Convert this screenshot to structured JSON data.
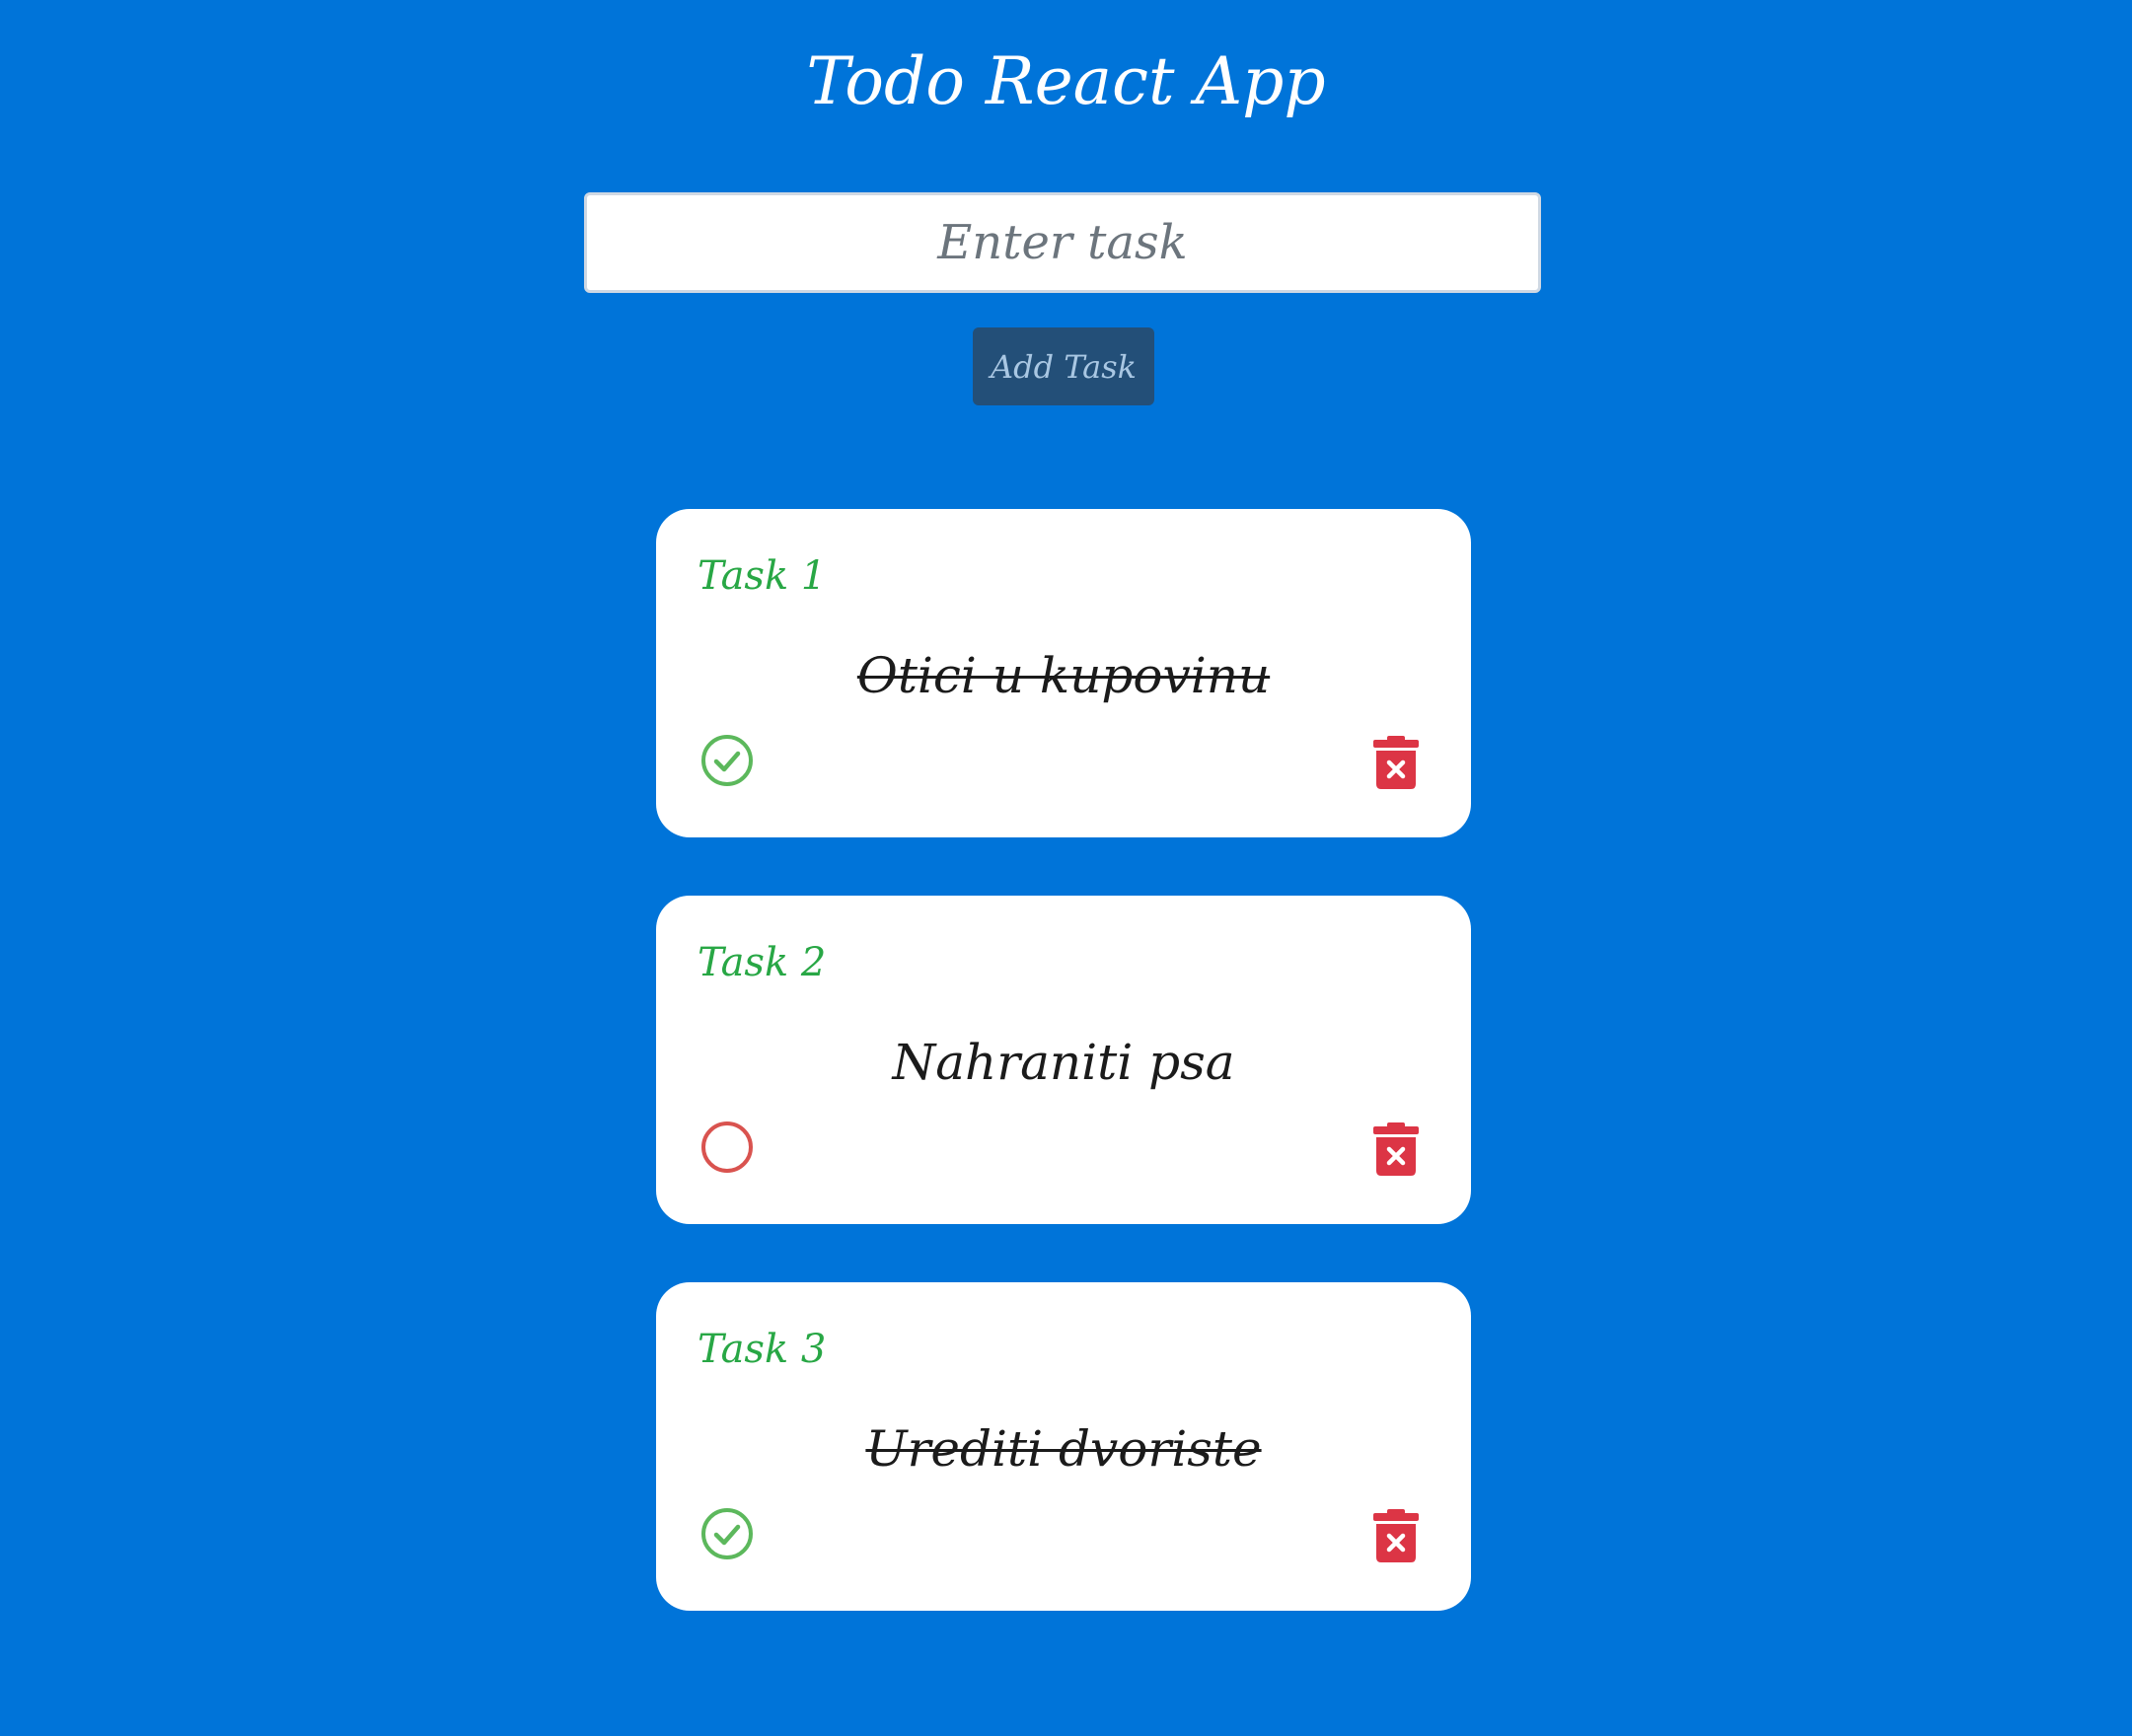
{
  "app": {
    "title": "Todo React App"
  },
  "input": {
    "placeholder": "Enter task",
    "value": ""
  },
  "add_button": {
    "label": "Add Task"
  },
  "colors": {
    "background": "#0074d9",
    "task_label": "#28a745",
    "done_icon": "#5cb85c",
    "undone_icon": "#d9534f",
    "delete_icon": "#dc3545",
    "add_button_bg": "#234f78"
  },
  "tasks": [
    {
      "label": "Task 1",
      "text": "Otici u kupovinu",
      "done": true,
      "status_icon": "check-circle-icon",
      "delete_icon": "trash-x-icon"
    },
    {
      "label": "Task 2",
      "text": "Nahraniti psa",
      "done": false,
      "status_icon": "empty-circle-icon",
      "delete_icon": "trash-x-icon"
    },
    {
      "label": "Task 3",
      "text": "Urediti dvoriste",
      "done": true,
      "status_icon": "check-circle-icon",
      "delete_icon": "trash-x-icon"
    }
  ]
}
